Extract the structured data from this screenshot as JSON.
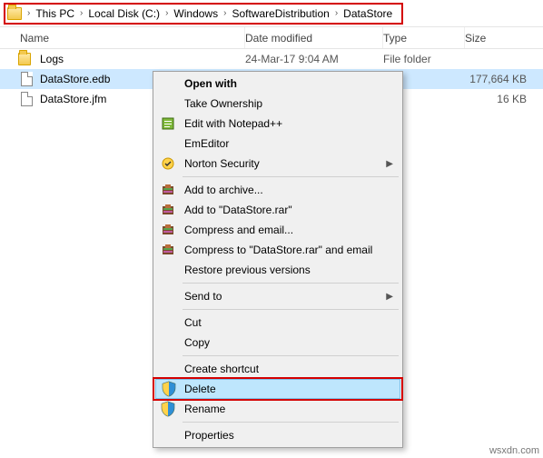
{
  "breadcrumb": {
    "items": [
      "This PC",
      "Local Disk (C:)",
      "Windows",
      "SoftwareDistribution",
      "DataStore"
    ]
  },
  "columns": {
    "name": "Name",
    "date": "Date modified",
    "type": "Type",
    "size": "Size"
  },
  "rows": [
    {
      "icon": "folder",
      "name": "Logs",
      "date": "24-Mar-17 9:04 AM",
      "type": "File folder",
      "size": "",
      "selected": false
    },
    {
      "icon": "file",
      "name": "DataStore.edb",
      "date": "",
      "type": "",
      "size": "177,664 KB",
      "selected": true
    },
    {
      "icon": "file",
      "name": "DataStore.jfm",
      "date": "",
      "type": "",
      "size": "16 KB",
      "selected": false
    }
  ],
  "ctx": {
    "open_with": "Open with",
    "take_ownership": "Take Ownership",
    "edit_notepadpp": "Edit with Notepad++",
    "emeditor": "EmEditor",
    "norton": "Norton Security",
    "add_archive": "Add to archive...",
    "add_rar": "Add to \"DataStore.rar\"",
    "compress_email": "Compress and email...",
    "compress_rar_email": "Compress to \"DataStore.rar\" and email",
    "restore": "Restore previous versions",
    "send_to": "Send to",
    "cut": "Cut",
    "copy": "Copy",
    "create_shortcut": "Create shortcut",
    "delete": "Delete",
    "rename": "Rename",
    "properties": "Properties"
  },
  "watermark": "wsxdn.com"
}
